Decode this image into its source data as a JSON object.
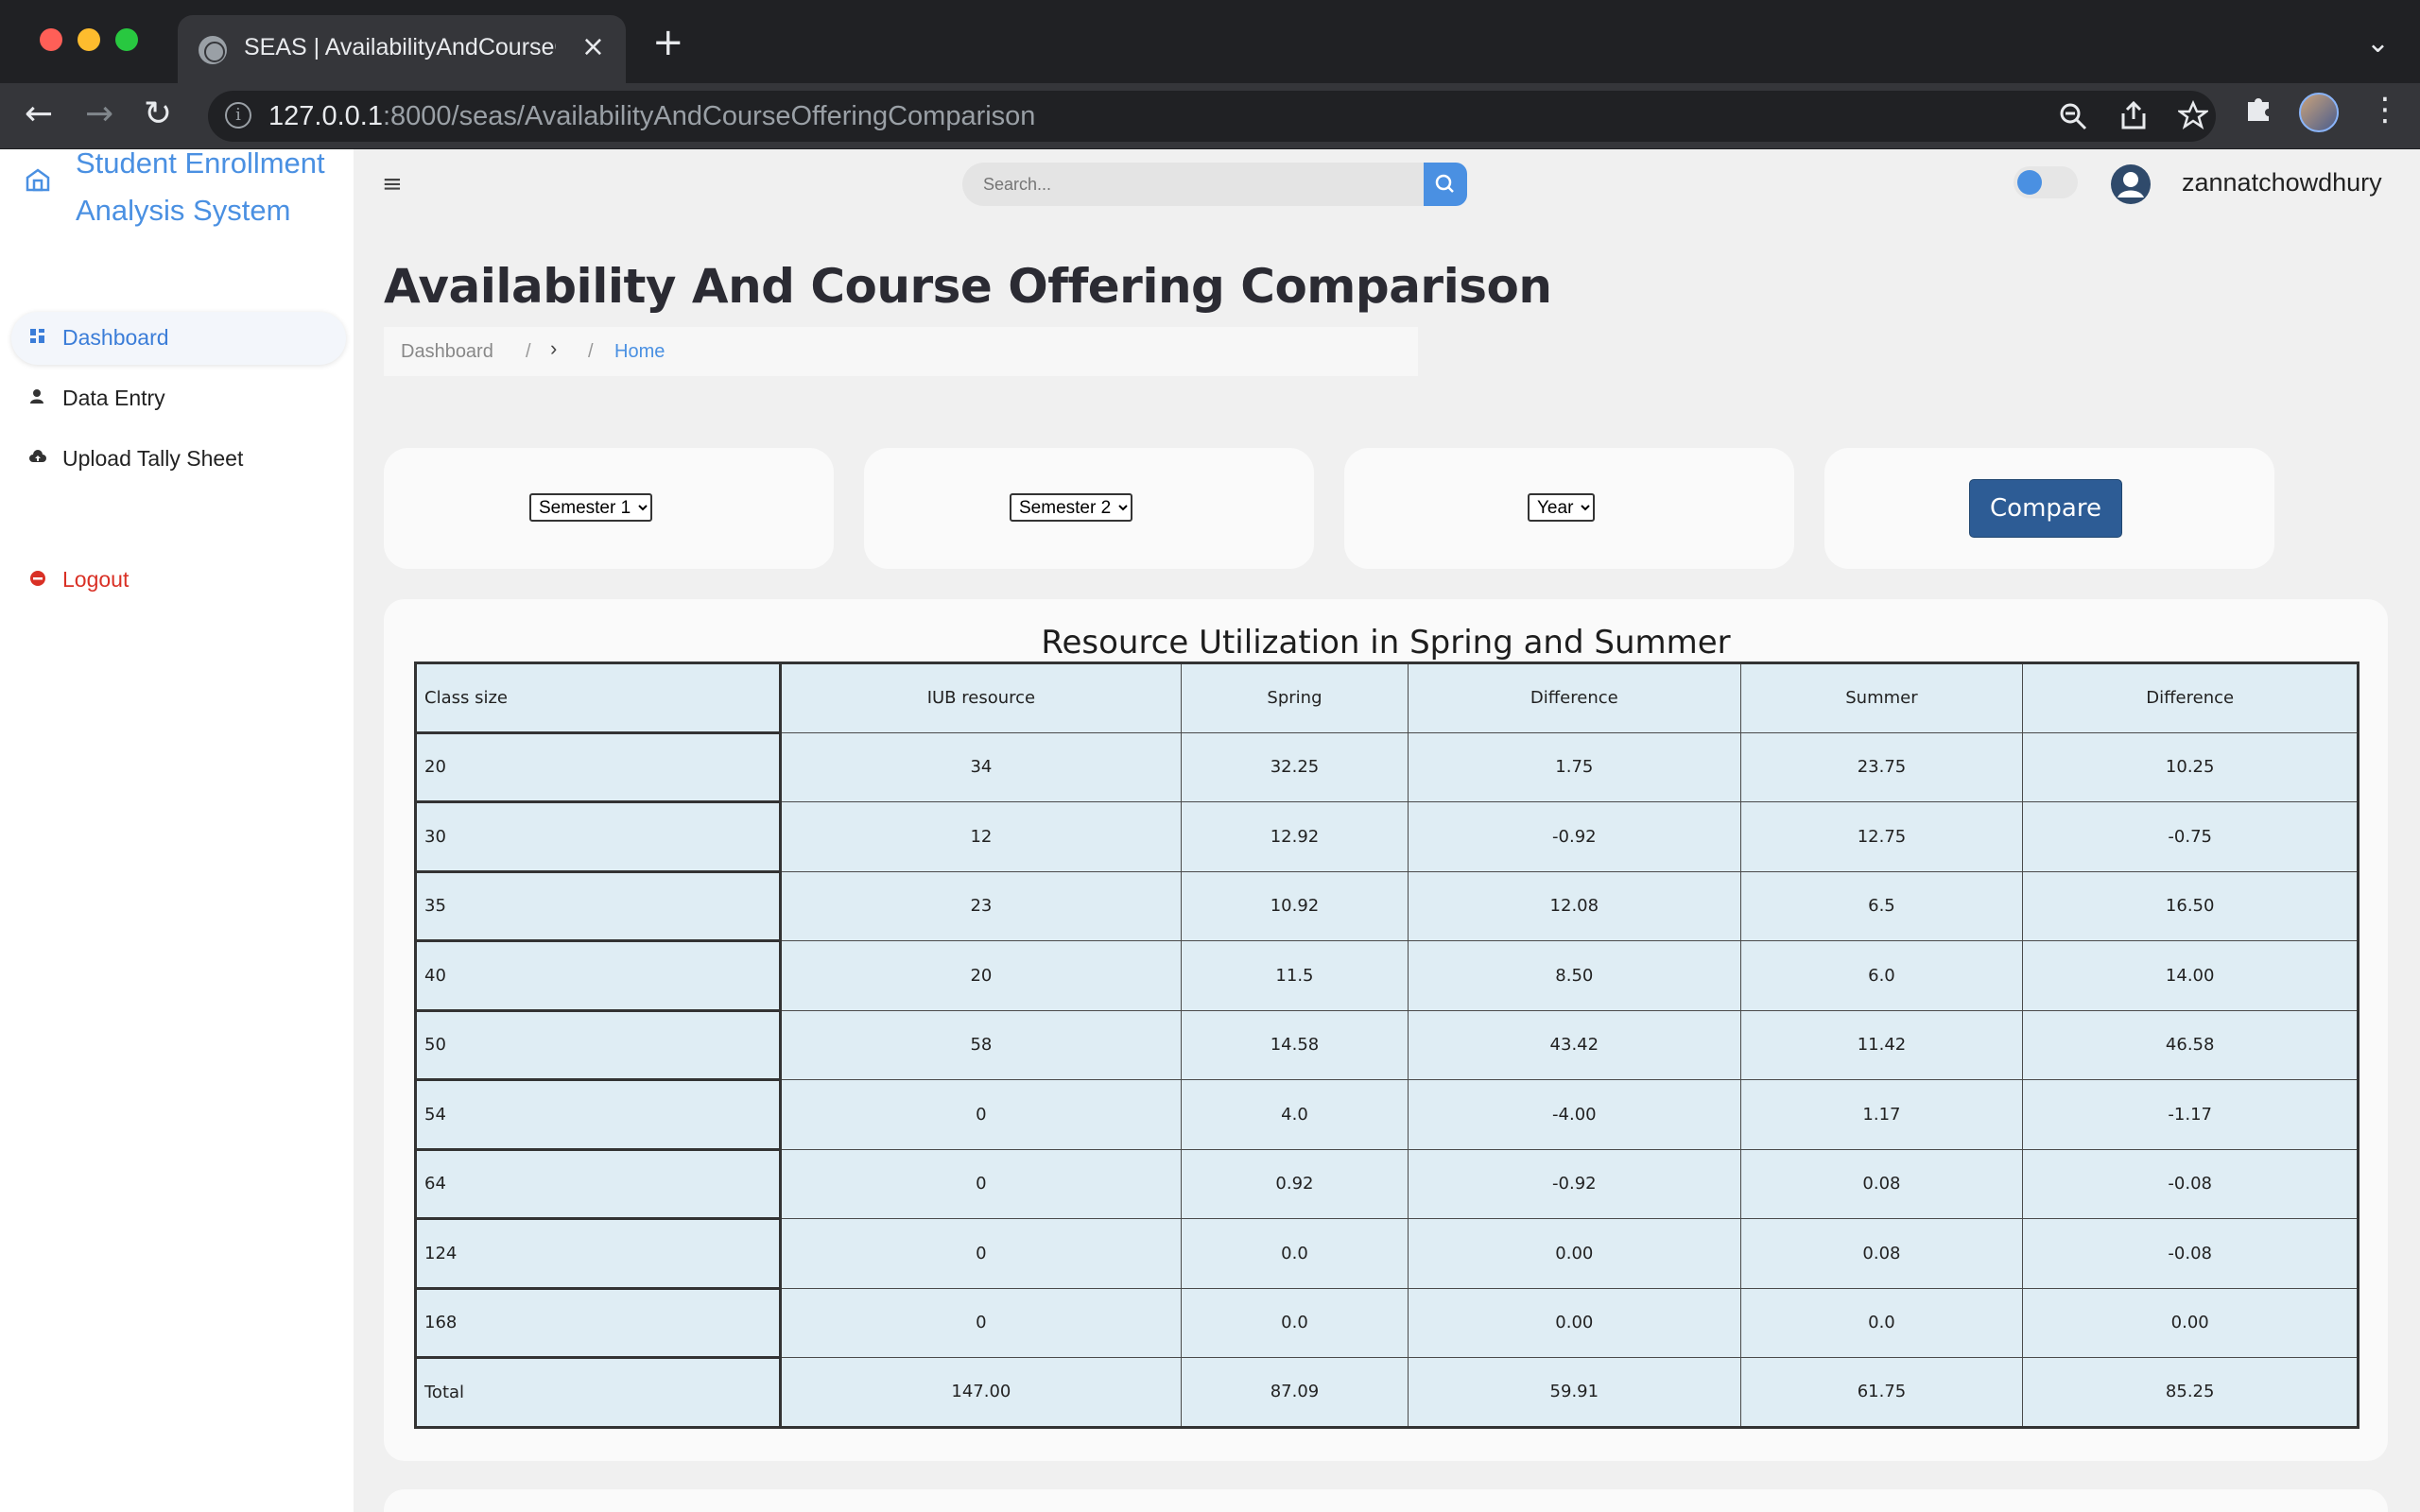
{
  "browser": {
    "tab_title": "SEAS | AvailabilityAndCourseOfferingComparison",
    "url_host": "127.0.0.1",
    "url_path": ":8000/seas/AvailabilityAndCourseOfferingComparison",
    "icons": [
      "globe-icon",
      "close-icon",
      "plus-icon",
      "chevron-down-icon",
      "back-icon",
      "forward-icon",
      "reload-icon",
      "info-icon",
      "zoom-icon",
      "share-icon",
      "star-icon",
      "puzzle-icon",
      "kebab-menu-icon"
    ]
  },
  "sidebar": {
    "brand": "Student Enrollment Analysis System",
    "items": [
      {
        "label": "Dashboard",
        "icon": "grid-icon",
        "active": true
      },
      {
        "label": "Data Entry",
        "icon": "user-icon"
      },
      {
        "label": "Upload Tally Sheet",
        "icon": "cloud-upload-icon"
      },
      {
        "label": "Logout",
        "icon": "logout-icon"
      }
    ]
  },
  "topbar": {
    "menu_icon": "≡",
    "search_placeholder": "Search...",
    "username": "zannatchowdhury"
  },
  "page": {
    "title": "Availability And Course Offering Comparison",
    "breadcrumb": {
      "first": "Dashboard",
      "sep": "/",
      "caret": "›",
      "current": "Home"
    }
  },
  "filters": {
    "semester1": "Semester 1",
    "semester2": "Semester 2",
    "year": "Year",
    "compare_label": "Compare"
  },
  "table": {
    "title": "Resource Utilization in Spring and Summer",
    "headers": [
      "Class size",
      "IUB resource",
      "Spring",
      "Difference",
      "Summer",
      "Difference"
    ],
    "rows": [
      [
        "20",
        "34",
        "32.25",
        "1.75",
        "23.75",
        "10.25"
      ],
      [
        "30",
        "12",
        "12.92",
        "-0.92",
        "12.75",
        "-0.75"
      ],
      [
        "35",
        "23",
        "10.92",
        "12.08",
        "6.5",
        "16.50"
      ],
      [
        "40",
        "20",
        "11.5",
        "8.50",
        "6.0",
        "14.00"
      ],
      [
        "50",
        "58",
        "14.58",
        "43.42",
        "11.42",
        "46.58"
      ],
      [
        "54",
        "0",
        "4.0",
        "-4.00",
        "1.17",
        "-1.17"
      ],
      [
        "64",
        "0",
        "0.92",
        "-0.92",
        "0.08",
        "-0.08"
      ],
      [
        "124",
        "0",
        "0.0",
        "0.00",
        "0.08",
        "-0.08"
      ],
      [
        "168",
        "0",
        "0.0",
        "0.00",
        "0.0",
        "0.00"
      ],
      [
        "Total",
        "147.00",
        "87.09",
        "59.91",
        "61.75",
        "85.25"
      ]
    ]
  },
  "colors": {
    "accent": "#4a90e2",
    "compare_button": "#2d5c95",
    "logout": "#d93025",
    "table_cell": "#dfedf4"
  }
}
